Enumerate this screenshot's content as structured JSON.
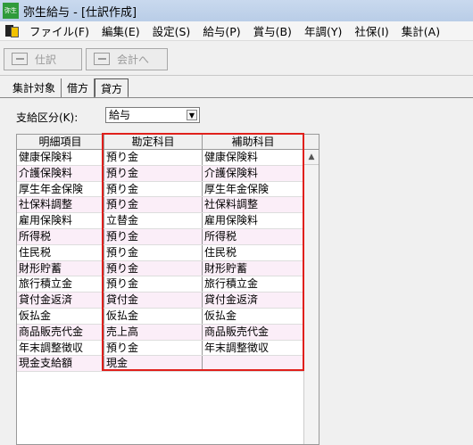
{
  "window": {
    "title": "弥生給与 - [仕訳作成]",
    "icon_text": "弥生"
  },
  "menu": [
    "ファイル(F)",
    "編集(E)",
    "設定(S)",
    "給与(P)",
    "賞与(B)",
    "年調(Y)",
    "社保(I)",
    "集計(A)"
  ],
  "toolbar": {
    "journal_label": "仕訳",
    "accounting_label": "会計へ"
  },
  "tabs": [
    "集計対象",
    "借方",
    "貸方"
  ],
  "selected_tab": "貸方",
  "filter": {
    "label": "支給区分(K):",
    "value": "給与"
  },
  "grid": {
    "headers": [
      "明細項目",
      "勘定科目",
      "補助科目"
    ],
    "rows": [
      [
        "健康保険料",
        "預り金",
        "健康保険料"
      ],
      [
        "介護保険料",
        "預り金",
        "介護保険料"
      ],
      [
        "厚生年金保険",
        "預り金",
        "厚生年金保険"
      ],
      [
        "社保料調整",
        "預り金",
        "社保料調整"
      ],
      [
        "雇用保険料",
        "立替金",
        "雇用保険料"
      ],
      [
        "所得税",
        "預り金",
        "所得税"
      ],
      [
        "住民税",
        "預り金",
        "住民税"
      ],
      [
        "財形貯蓄",
        "預り金",
        "財形貯蓄"
      ],
      [
        "旅行積立金",
        "預り金",
        "旅行積立金"
      ],
      [
        "貸付金返済",
        "貸付金",
        "貸付金返済"
      ],
      [
        "仮払金",
        "仮払金",
        "仮払金"
      ],
      [
        "商品販売代金",
        "売上高",
        "商品販売代金"
      ],
      [
        "年末調整徴収",
        "預り金",
        "年末調整徴収"
      ],
      [
        "現金支給額",
        "現金",
        ""
      ]
    ]
  },
  "colors": {
    "highlight": "#e0201c",
    "row_alt": "#fbeef8",
    "titlebar": "#c9d9ee"
  }
}
